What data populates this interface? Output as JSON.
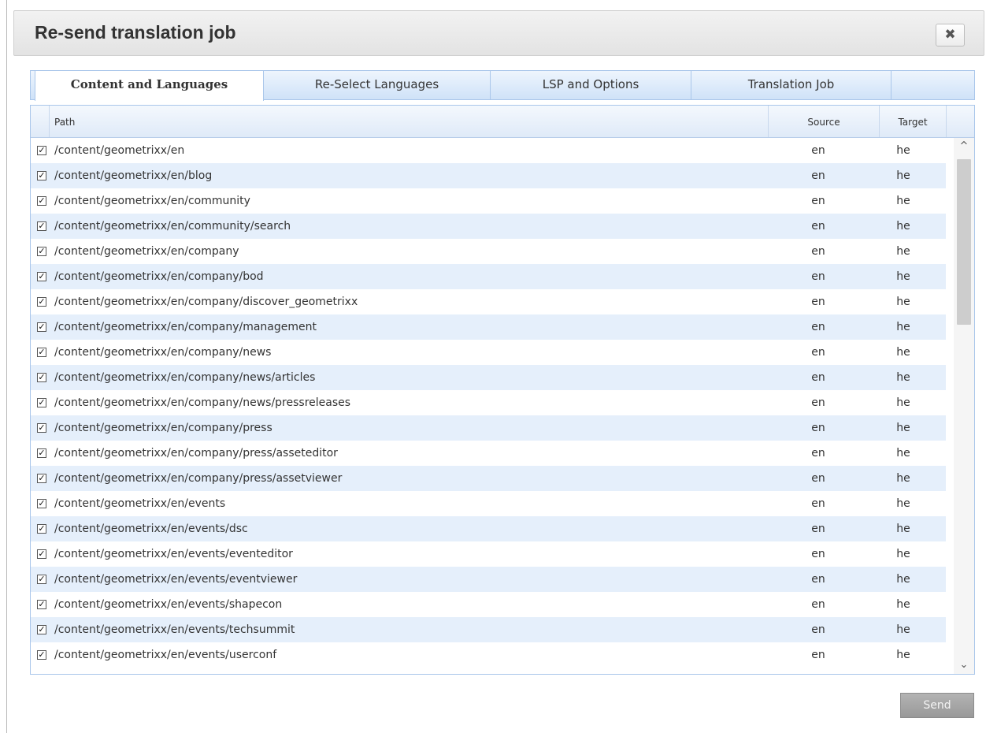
{
  "dialog": {
    "title": "Re-send translation job",
    "close_icon": "close-icon"
  },
  "tabs": [
    {
      "label": "Content and Languages",
      "active": true
    },
    {
      "label": "Re-Select Languages",
      "active": false
    },
    {
      "label": "LSP and Options",
      "active": false
    },
    {
      "label": "Translation Job",
      "active": false
    }
  ],
  "grid": {
    "columns": {
      "path": "Path",
      "source": "Source",
      "target": "Target"
    },
    "rows": [
      {
        "checked": true,
        "path": "/content/geometrixx/en",
        "source": "en",
        "target": "he"
      },
      {
        "checked": true,
        "path": "/content/geometrixx/en/blog",
        "source": "en",
        "target": "he"
      },
      {
        "checked": true,
        "path": "/content/geometrixx/en/community",
        "source": "en",
        "target": "he"
      },
      {
        "checked": true,
        "path": "/content/geometrixx/en/community/search",
        "source": "en",
        "target": "he"
      },
      {
        "checked": true,
        "path": "/content/geometrixx/en/company",
        "source": "en",
        "target": "he"
      },
      {
        "checked": true,
        "path": "/content/geometrixx/en/company/bod",
        "source": "en",
        "target": "he"
      },
      {
        "checked": true,
        "path": "/content/geometrixx/en/company/discover_geometrixx",
        "source": "en",
        "target": "he"
      },
      {
        "checked": true,
        "path": "/content/geometrixx/en/company/management",
        "source": "en",
        "target": "he"
      },
      {
        "checked": true,
        "path": "/content/geometrixx/en/company/news",
        "source": "en",
        "target": "he"
      },
      {
        "checked": true,
        "path": "/content/geometrixx/en/company/news/articles",
        "source": "en",
        "target": "he"
      },
      {
        "checked": true,
        "path": "/content/geometrixx/en/company/news/pressreleases",
        "source": "en",
        "target": "he"
      },
      {
        "checked": true,
        "path": "/content/geometrixx/en/company/press",
        "source": "en",
        "target": "he"
      },
      {
        "checked": true,
        "path": "/content/geometrixx/en/company/press/asseteditor",
        "source": "en",
        "target": "he"
      },
      {
        "checked": true,
        "path": "/content/geometrixx/en/company/press/assetviewer",
        "source": "en",
        "target": "he"
      },
      {
        "checked": true,
        "path": "/content/geometrixx/en/events",
        "source": "en",
        "target": "he"
      },
      {
        "checked": true,
        "path": "/content/geometrixx/en/events/dsc",
        "source": "en",
        "target": "he"
      },
      {
        "checked": true,
        "path": "/content/geometrixx/en/events/eventeditor",
        "source": "en",
        "target": "he"
      },
      {
        "checked": true,
        "path": "/content/geometrixx/en/events/eventviewer",
        "source": "en",
        "target": "he"
      },
      {
        "checked": true,
        "path": "/content/geometrixx/en/events/shapecon",
        "source": "en",
        "target": "he"
      },
      {
        "checked": true,
        "path": "/content/geometrixx/en/events/techsummit",
        "source": "en",
        "target": "he"
      },
      {
        "checked": true,
        "path": "/content/geometrixx/en/events/userconf",
        "source": "en",
        "target": "he"
      }
    ]
  },
  "footer": {
    "send_label": "Send"
  }
}
